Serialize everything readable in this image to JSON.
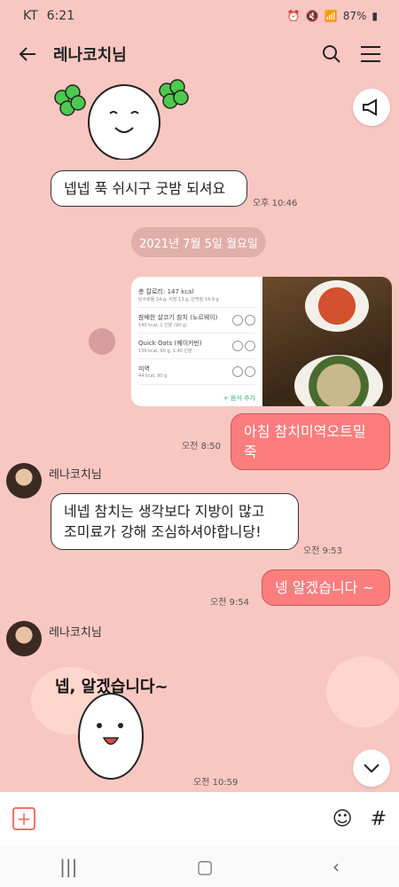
{
  "status": {
    "carrier": "KT",
    "time": "6:21",
    "battery": "87%"
  },
  "header": {
    "title": "레나코치님"
  },
  "messages": {
    "m1_text": "넵넵 푹 쉬시구 굿밤 되셔요",
    "m1_time": "오후 10:46",
    "date_divider": "2021년 7월 5일 월요일",
    "m2_text": "아침 참치미역오트밀죽",
    "m2_time": "오전 8:50",
    "sender_name": "레나코치님",
    "m3_line1": "네넵 참치는 생각보다 지방이 많고",
    "m3_line2": "조미료가 강해 조심하셔야합니당!",
    "m3_time": "오전 9:53",
    "m4_text": "넹 알겠습니다 ~",
    "m4_time": "오전 9:54",
    "sender_name2": "레나코치님",
    "sticker_text": "넵, 알겠습니다~",
    "m5_time": "오전 10:59"
  },
  "food_card": {
    "header": "총 칼로리: 147 kcal",
    "header_sub": "탄수화물 14 g, 지방 13 g, 단백질 14.9 g",
    "items": [
      {
        "name": "참배한 살코기 참치 (노르웨이)",
        "sub": "140 kcal, 1 인분 (90 g)"
      },
      {
        "name": "Quick Oats (퀘이커빈)",
        "sub": "139 kcal, 90 g, 1.40 인분"
      },
      {
        "name": "미역",
        "sub": "44 kcal, 90 g"
      }
    ],
    "add_label": "+ 음식 추가"
  },
  "colors": {
    "background": "#f9c7c2",
    "my_bubble": "#fb7d7d",
    "accent": "#f0706a"
  },
  "icons": {
    "back": "back-arrow-icon",
    "search": "search-icon",
    "menu": "menu-icon",
    "notice": "megaphone-icon",
    "add": "plus-icon",
    "emoji": "emoji-icon",
    "hash": "hash-icon"
  }
}
